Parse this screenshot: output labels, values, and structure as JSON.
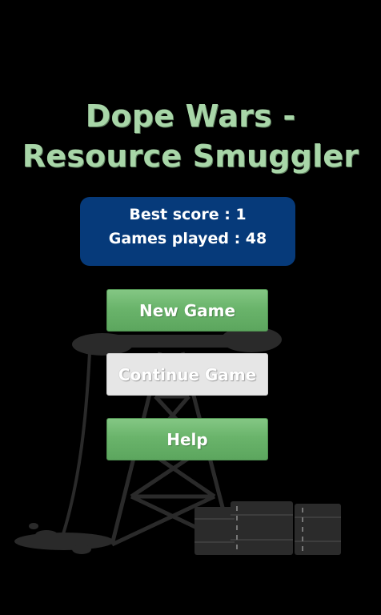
{
  "app": {
    "title": "Dope Wars - Resource Smuggler"
  },
  "stats": {
    "best_score": "Best score : 1",
    "games_played": "Games played : 48"
  },
  "menu": {
    "new_game": "New Game",
    "continue_game": "Continue Game",
    "help": "Help"
  },
  "colors": {
    "background": "#000000",
    "title": "#a8d6a8",
    "stats_panel": "#063a7a",
    "primary_button": "#6ab46b",
    "disabled_button": "#e6e6e6"
  },
  "icons": {
    "background_art": "oil-derrick-and-barrels-icon"
  }
}
